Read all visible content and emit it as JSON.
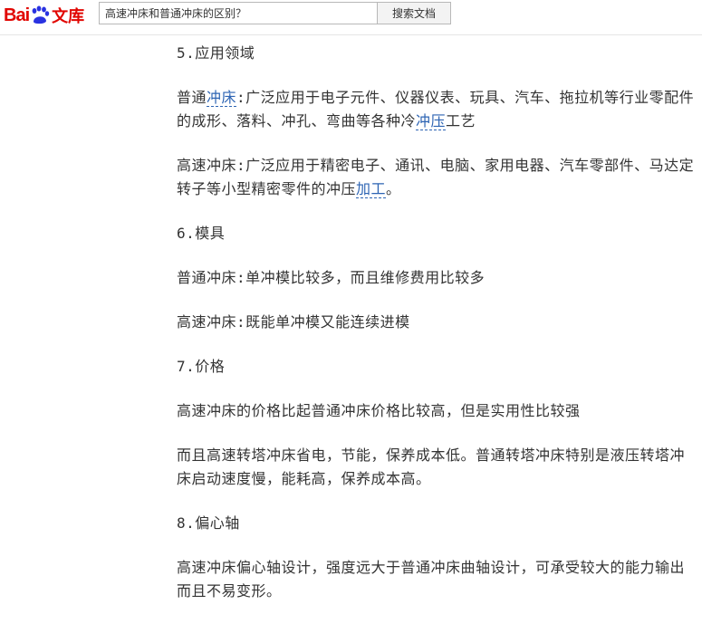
{
  "header": {
    "logo": {
      "bai": "Bai",
      "du": "du",
      "wenku": "文库"
    },
    "search": {
      "value": "高速冲床和普通冲床的区别？",
      "placeholder": ""
    },
    "search_button": "搜索文档"
  },
  "sections": {
    "s5": {
      "title": "5.应用领域",
      "p1_a": "普通",
      "p1_link1": "冲床",
      "p1_b": ":广泛应用于电子元件、仪器仪表、玩具、汽车、拖拉机等行业零配件的成形、落料、冲孔、弯曲等各种冷",
      "p1_link2": "冲压",
      "p1_c": "工艺",
      "p2_a": "高速冲床:广泛应用于精密电子、通讯、电脑、家用电器、汽车零部件、马达定转子等小型精密零件的冲压",
      "p2_link": "加工",
      "p2_b": "。"
    },
    "s6": {
      "title": "6.模具",
      "p1": "普通冲床:单冲模比较多，而且维修费用比较多",
      "p2": "高速冲床:既能单冲模又能连续进模"
    },
    "s7": {
      "title": "7.价格",
      "p1": "高速冲床的价格比起普通冲床价格比较高，但是实用性比较强",
      "p2": "而且高速转塔冲床省电，节能，保养成本低。普通转塔冲床特别是液压转塔冲床启动速度慢，能耗高，保养成本高。"
    },
    "s8": {
      "title": "8.偏心轴",
      "p1": "高速冲床偏心轴设计，强度远大于普通冲床曲轴设计，可承受较大的能力输出而且不易变形。"
    }
  }
}
